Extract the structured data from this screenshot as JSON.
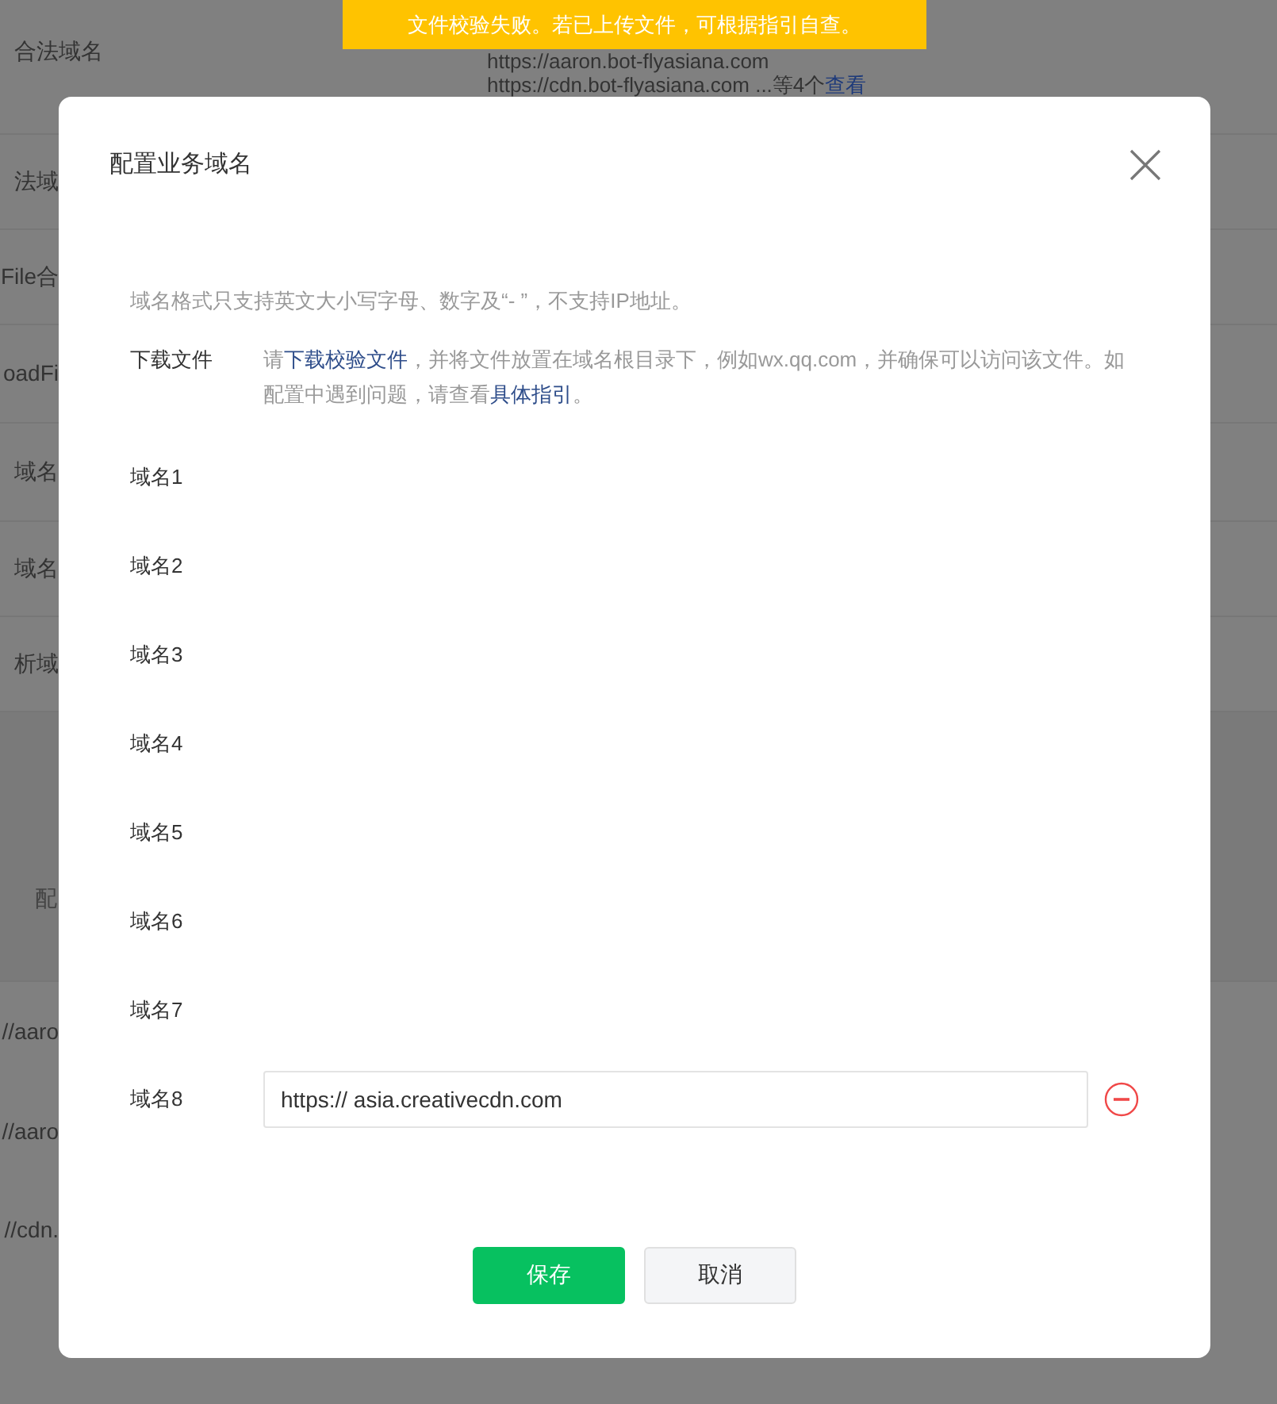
{
  "background": {
    "header_label": "合法域名",
    "header_values": [
      "https://aaron.bot-flyasiana.com",
      "https://cdn.bot-flyasiana.com ...等4个"
    ],
    "header_link": "查看",
    "left_fragments": [
      "法域",
      "File合",
      "oadFi",
      "域名",
      "域名",
      "析域",
      "配",
      "//aaro",
      "//aaro",
      "//cdn."
    ]
  },
  "toast": "文件校验失败。若已上传文件，可根据指引自查。",
  "dialog": {
    "title": "配置业务域名",
    "note": "域名格式只支持英文大小写字母、数字及“- ”，不支持IP地址。",
    "download": {
      "label": "下载文件",
      "parts": [
        {
          "kind": "text",
          "text": "请"
        },
        {
          "kind": "link",
          "text": "下载校验文件"
        },
        {
          "kind": "text",
          "text": "，并将文件放置在域名根目录下，例如wx.qq.com，并确保可以访问该文件。如配置中遇到问题，请查看"
        },
        {
          "kind": "link",
          "text": "具体指引"
        },
        {
          "kind": "text",
          "text": "。"
        }
      ]
    },
    "domains": [
      {
        "label": "域名1",
        "kind": "label"
      },
      {
        "label": "域名2",
        "kind": "label"
      },
      {
        "label": "域名3",
        "kind": "label"
      },
      {
        "label": "域名4",
        "kind": "label"
      },
      {
        "label": "域名5",
        "kind": "label"
      },
      {
        "label": "域名6",
        "kind": "label"
      },
      {
        "label": "域名7",
        "kind": "label"
      },
      {
        "label": "域名8",
        "kind": "input",
        "value": "https:// asia.creativecdn.com"
      }
    ],
    "buttons": [
      {
        "label": "保存",
        "kind": "primary"
      },
      {
        "label": "取消",
        "kind": "default"
      }
    ]
  }
}
